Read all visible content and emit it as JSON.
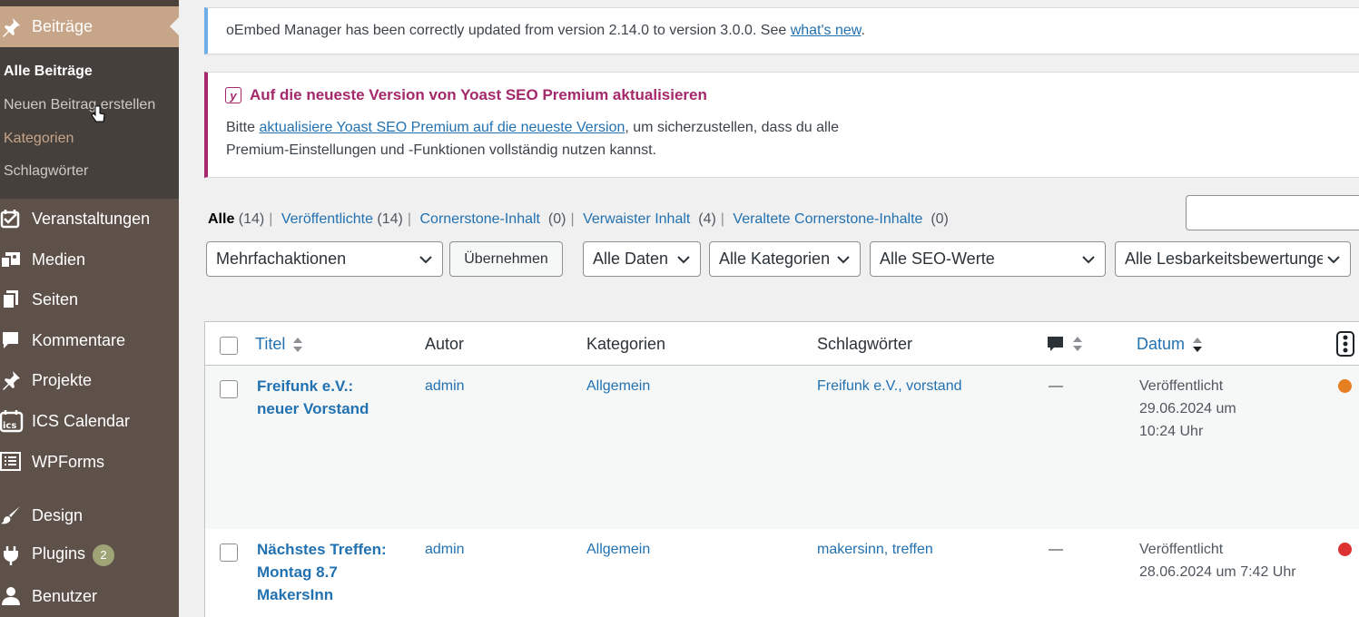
{
  "sidebar": {
    "active_label": "Beiträge",
    "submenu": [
      "Alle Beiträge",
      "Neuen Beitrag erstellen",
      "Kategorien",
      "Schlagwörter"
    ],
    "items": [
      {
        "label": "Veranstaltungen",
        "icon": "calendar-event-icon"
      },
      {
        "label": "Medien",
        "icon": "media-icon"
      },
      {
        "label": "Seiten",
        "icon": "pages-icon"
      },
      {
        "label": "Kommentare",
        "icon": "comment-icon"
      },
      {
        "label": "Projekte",
        "icon": "pin-icon"
      },
      {
        "label": "ICS Calendar",
        "icon": "ics-calendar-icon"
      },
      {
        "label": "WPForms",
        "icon": "wpforms-icon"
      },
      {
        "label": "Design",
        "icon": "brush-icon"
      },
      {
        "label": "Plugins",
        "icon": "plugin-icon",
        "badge": "2"
      },
      {
        "label": "Benutzer",
        "icon": "user-icon"
      }
    ],
    "colors": {
      "bg": "#5e5149",
      "active": "#c7a589",
      "submenu_bg": "#46403c"
    }
  },
  "notices": {
    "oembed": {
      "text": "oEmbed Manager has been correctly updated from version 2.14.0 to version 3.0.0. See ",
      "link": "what's new",
      "suffix": "."
    },
    "yoast": {
      "title": "Auf die neueste Version von Yoast SEO Premium aktualisieren",
      "body_prefix": "Bitte ",
      "body_link": "aktualisiere Yoast SEO Premium auf die neueste Version",
      "body_suffix": ", um sicherzustellen, dass du alle Premium-Einstellungen und -Funktionen vollständig nutzen kannst."
    }
  },
  "views": {
    "all": "Alle",
    "all_count": "(14)",
    "published": "Veröffentlichte",
    "published_count": "(14)",
    "cornerstone": "Cornerstone-Inhalt",
    "cornerstone_count": "(0)",
    "orphaned": "Verwaister Inhalt",
    "orphaned_count": "(4)",
    "stale": "Veraltete Cornerstone-Inhalte",
    "stale_count": "(0)"
  },
  "filters": {
    "bulk": "Mehrfachaktionen",
    "apply": "Übernehmen",
    "dates": "Alle Daten",
    "categories": "Alle Kategorien",
    "seo": "Alle SEO-Werte",
    "readability": "Alle Lesbarkeitsbewertungen"
  },
  "table": {
    "columns": {
      "title": "Titel",
      "author": "Autor",
      "categories": "Kategorien",
      "tags": "Schlagwörter",
      "date": "Datum"
    },
    "rows": [
      {
        "title_line1": "Freifunk e.V.:",
        "title_line2": "neuer Vorstand",
        "title_line3": "",
        "author": "admin",
        "category": "Allgemein",
        "tags": "Freifunk e.V., vorstand",
        "comments": "—",
        "status": "Veröffentlicht",
        "date_line1": "29.06.2024 um",
        "date_line2": "10:24 Uhr",
        "seo_color": "#e67e22"
      },
      {
        "title_line1": "Nächstes Treffen:",
        "title_line2": "Montag 8.7",
        "title_line3": "MakersInn",
        "author": "admin",
        "category": "Allgemein",
        "tags": "makersinn, treffen",
        "comments": "—",
        "status": "Veröffentlicht",
        "date_line1": "28.06.2024 um 7:42 Uhr",
        "date_line2": "",
        "seo_color": "#dc3232"
      }
    ]
  }
}
